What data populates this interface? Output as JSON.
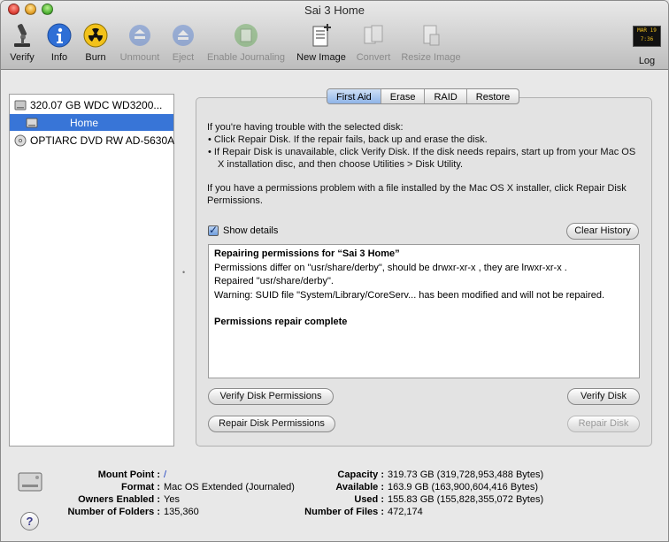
{
  "window": {
    "title": "Sai 3 Home"
  },
  "toolbar": {
    "verify": "Verify",
    "info": "Info",
    "burn": "Burn",
    "unmount": "Unmount",
    "eject": "Eject",
    "enable_journaling": "Enable Journaling",
    "new_image": "New Image",
    "convert": "Convert",
    "resize_image": "Resize Image",
    "log": "Log",
    "log_icon_text": "MAR 19 7:36"
  },
  "sidebar": {
    "items": [
      {
        "label": "320.07 GB WDC WD3200..."
      },
      {
        "label": "Home"
      },
      {
        "label": "OPTIARC DVD RW AD-5630A"
      }
    ]
  },
  "tabs": [
    {
      "label": "First Aid"
    },
    {
      "label": "Erase"
    },
    {
      "label": "RAID"
    },
    {
      "label": "Restore"
    }
  ],
  "first_aid": {
    "intro": "If you're having trouble with the selected disk:",
    "bullet1": "Click Repair Disk. If the repair fails, back up and erase the disk.",
    "bullet2": "If Repair Disk is unavailable, click Verify Disk. If the disk needs repairs, start up from your Mac OS X installation disc, and then choose Utilities > Disk Utility.",
    "permissions": "If you have a permissions problem with a file installed by the Mac OS X installer, click Repair Disk Permissions.",
    "show_details": "Show details",
    "clear_history": "Clear History",
    "log": {
      "heading": "Repairing permissions for “Sai 3 Home”",
      "line1": "Permissions differ on \"usr/share/derby\", should be drwxr-xr-x , they are lrwxr-xr-x .",
      "line2": "Repaired \"usr/share/derby\".",
      "line3": "Warning: SUID file \"System/Library/CoreServ... has been modified and will not be repaired.",
      "complete": "Permissions repair complete"
    },
    "verify_permissions": "Verify Disk Permissions",
    "repair_permissions": "Repair Disk Permissions",
    "verify_disk": "Verify Disk",
    "repair_disk": "Repair Disk"
  },
  "details": {
    "mount_point_label": "Mount Point :",
    "mount_point_value": "/",
    "format_label": "Format :",
    "format_value": "Mac OS Extended (Journaled)",
    "owners_label": "Owners Enabled :",
    "owners_value": "Yes",
    "folders_label": "Number of Folders :",
    "folders_value": "135,360",
    "capacity_label": "Capacity :",
    "capacity_value": "319.73 GB (319,728,953,488 Bytes)",
    "available_label": "Available :",
    "available_value": "163.9 GB (163,900,604,416 Bytes)",
    "used_label": "Used :",
    "used_value": "155.83 GB (155,828,355,072 Bytes)",
    "files_label": "Number of Files :",
    "files_value": "472,174"
  },
  "help": "?"
}
